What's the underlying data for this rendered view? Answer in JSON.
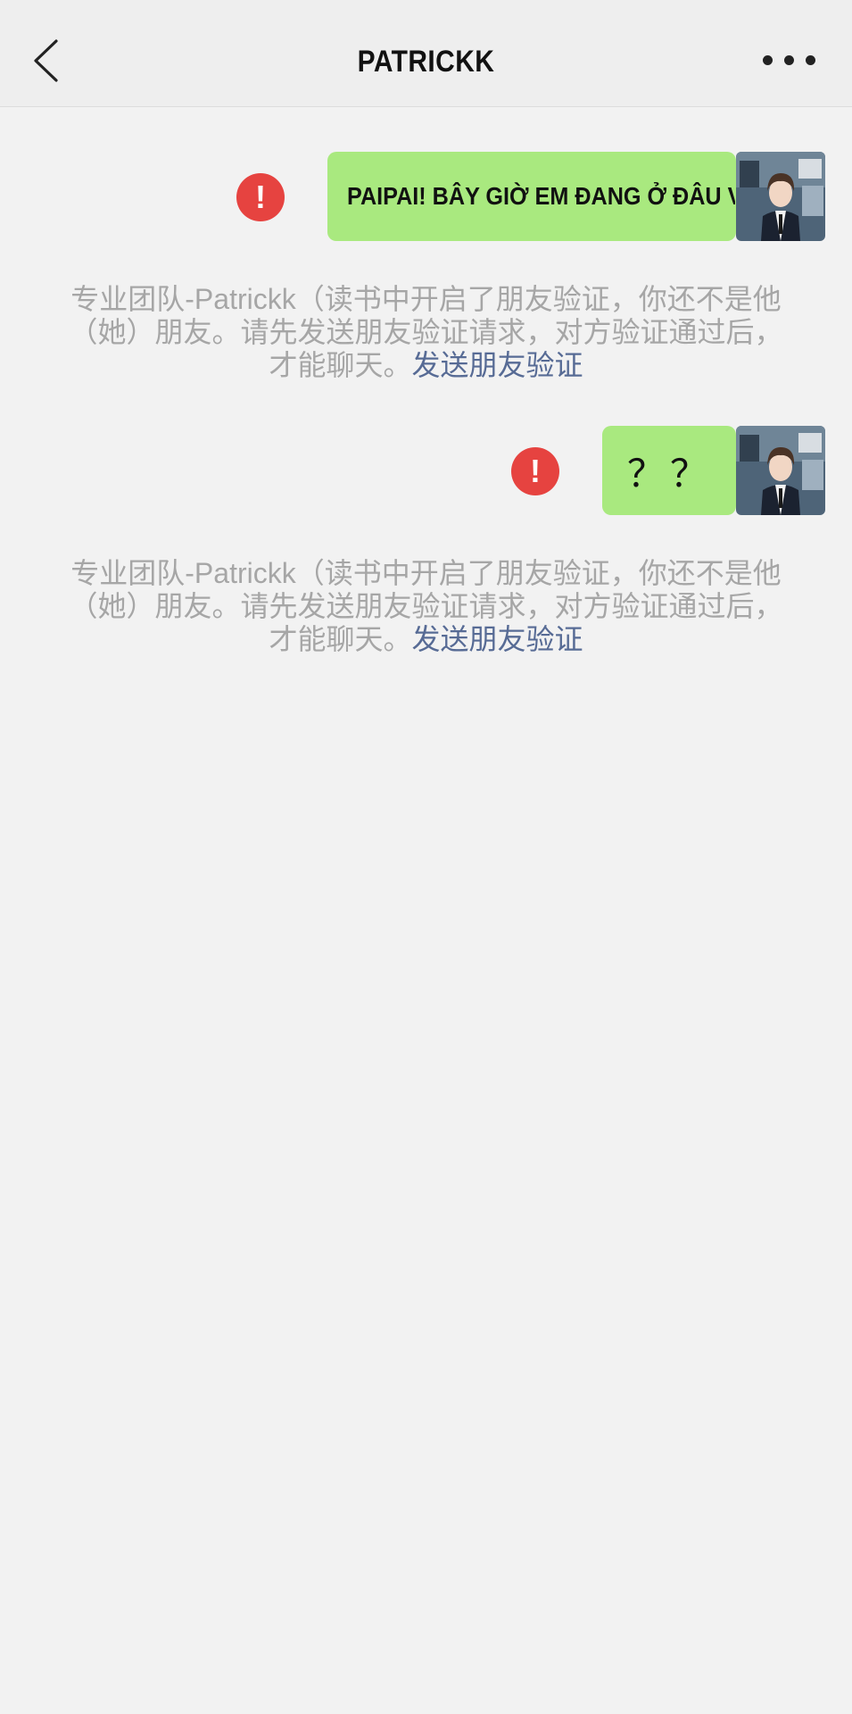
{
  "header": {
    "title": "PATRICKK",
    "back_icon": "chevron-left-icon",
    "more_icon": "more-horizontal-icon"
  },
  "messages": [
    {
      "text": "PAIPAI! BÂY GIỜ EM ĐANG Ở ĐÂU VẬY?",
      "status_icon": "error-icon",
      "notice": "专业团队-Patrickk（读书中开启了朋友验证，你还不是他（她）朋友。请先发送朋友验证请求，对方验证通过后，才能聊天。",
      "notice_link": "发送朋友验证"
    },
    {
      "text": "？？",
      "status_icon": "error-icon",
      "notice": "专业团队-Patrickk（读书中开启了朋友验证，你还不是他（她）朋友。请先发送朋友验证请求，对方验证通过后，才能聊天。",
      "notice_link": "发送朋友验证"
    }
  ],
  "colors": {
    "background": "#f2f2f2",
    "bubble": "#a9e97f",
    "error": "#e64340",
    "notice_text": "#a6a6a6",
    "link": "#576b95"
  }
}
